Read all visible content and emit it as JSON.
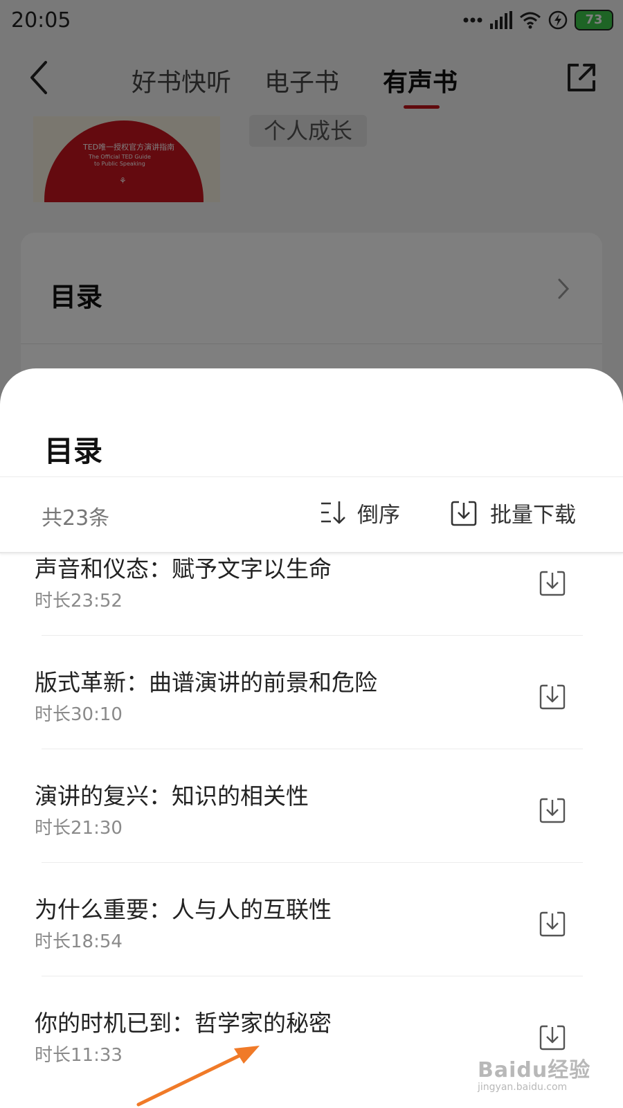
{
  "status_bar": {
    "time": "20:05",
    "battery": "73",
    "icons": [
      "more-dots-icon",
      "signal-icon",
      "wifi-icon",
      "charging-icon",
      "battery-icon"
    ]
  },
  "nav": {
    "tabs": [
      {
        "label": "好书快听",
        "active": false
      },
      {
        "label": "电子书",
        "active": false
      },
      {
        "label": "有声书",
        "active": true
      }
    ],
    "accent_color": "#c0141a"
  },
  "book": {
    "cover_line1": "TED唯一授权官方演讲指南",
    "cover_line2": "The Official TED Guide",
    "cover_line3": "to Public Speaking",
    "tag": "个人成长"
  },
  "toc_card": {
    "title": "目录"
  },
  "sheet": {
    "title": "目录",
    "count": "共23条",
    "sort_label": "倒序",
    "batch_label": "批量下载",
    "episodes": [
      {
        "title": "声音和仪态：赋予文字以生命",
        "duration": "时长23:52"
      },
      {
        "title": "版式革新：曲谱演讲的前景和危险",
        "duration": "时长30:10"
      },
      {
        "title": "演讲的复兴：知识的相关性",
        "duration": "时长21:30"
      },
      {
        "title": "为什么重要：人与人的互联性",
        "duration": "时长18:54"
      },
      {
        "title": "你的时机已到：哲学家的秘密",
        "duration": "时长11:33"
      }
    ]
  },
  "watermark": {
    "main": "Baidu经验",
    "sub": "jingyan.baidu.com"
  },
  "annotation_color": "#f07a28"
}
